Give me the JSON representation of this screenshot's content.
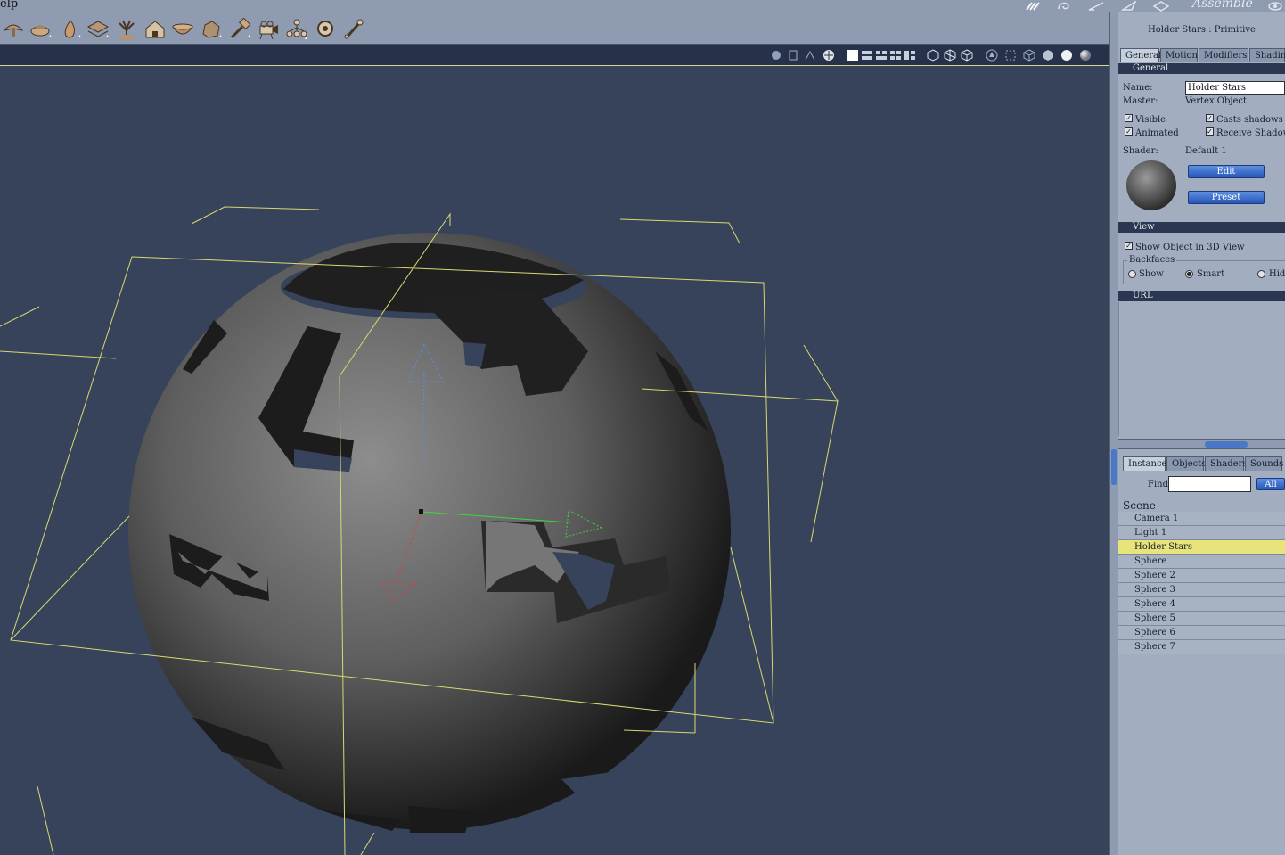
{
  "menubar": {
    "help": "elp",
    "room": "Assemble"
  },
  "toolbar": {
    "tools": [
      "landscape-tool",
      "terrain-tool",
      "fire-tool",
      "layers-tool",
      "plant-tool",
      "house-tool",
      "bowl-tool",
      "rock-tool",
      "hammer-tool",
      "camera-tool",
      "group-tool",
      "target-tool",
      "bone-tool"
    ]
  },
  "panel": {
    "title": "Holder Stars : Primitive",
    "tabs": [
      "General",
      "Motion",
      "Modifiers",
      "Shading"
    ],
    "general_header": "General",
    "name_label": "Name:",
    "name_value": "Holder Stars",
    "master_label": "Master:",
    "master_value": "Vertex Object",
    "visible": "Visible",
    "casts_shadows": "Casts shadows",
    "animated": "Animated",
    "receive_shadow": "Receive Shadow",
    "shader_label": "Shader:",
    "shader_value": "Default 1",
    "edit": "Edit",
    "preset": "Preset",
    "view_header": "View",
    "show_in_3d": "Show Object in 3D View",
    "backfaces": "Backfaces",
    "show": "Show",
    "smart": "Smart",
    "hide": "Hide",
    "url_header": "URL"
  },
  "browser": {
    "tabs": [
      "Instances",
      "Objects",
      "Shaders",
      "Sounds"
    ],
    "find_label": "Find:",
    "find_value": "",
    "all": "All",
    "scene_label": "Scene",
    "items": [
      "Camera 1",
      "Light 1",
      "Holder Stars",
      "Sphere",
      "Sphere 2",
      "Sphere 3",
      "Sphere 4",
      "Sphere 5",
      "Sphere 6",
      "Sphere 7"
    ],
    "selected": "Holder Stars"
  },
  "colors": {
    "viewport": "#37435a",
    "selection": "#e6e47a",
    "bbox": "#d8d870"
  }
}
